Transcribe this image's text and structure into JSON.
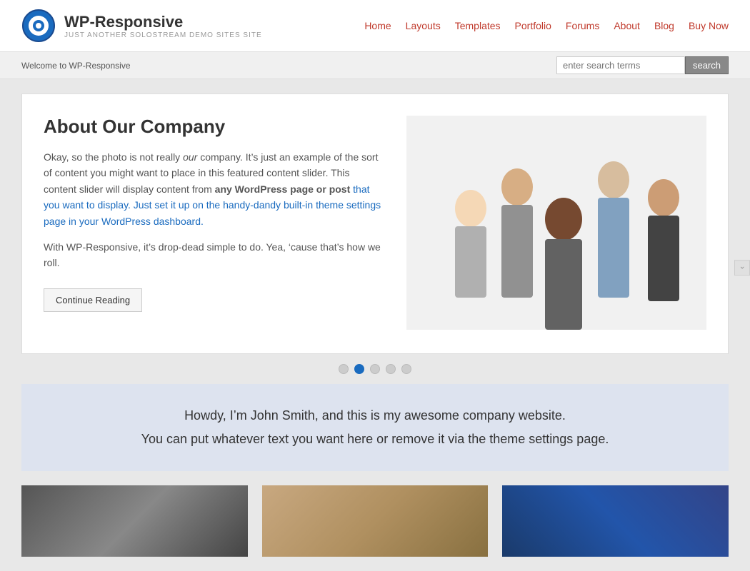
{
  "site": {
    "logo_title": "WP-Responsive",
    "logo_subtitle": "Just another Solostream demo sites site",
    "logo_icon_color_outer": "#1a6bbf",
    "logo_icon_color_inner": "#fff"
  },
  "nav": {
    "items": [
      {
        "label": "Home",
        "url": "#"
      },
      {
        "label": "Layouts",
        "url": "#"
      },
      {
        "label": "Templates",
        "url": "#"
      },
      {
        "label": "Portfolio",
        "url": "#"
      },
      {
        "label": "Forums",
        "url": "#"
      },
      {
        "label": "About",
        "url": "#"
      },
      {
        "label": "Blog",
        "url": "#"
      },
      {
        "label": "Buy Now",
        "url": "#"
      }
    ]
  },
  "toolbar": {
    "welcome_text": "Welcome to WP-Responsive"
  },
  "search": {
    "placeholder": "enter search terms",
    "button_label": "search"
  },
  "slide": {
    "title": "About Our Company",
    "paragraph1_plain": "Okay, so the photo is not really ",
    "paragraph1_italic": "our",
    "paragraph1_rest": " company. It’s just an example of the sort of content you might want to place in this featured content slider. This content slider will display content from ",
    "paragraph1_bold": "any WordPress page or post",
    "paragraph1_end": " that you want to display. Just set it up on the handy-dandy built-in theme settings page in your WordPress dashboard.",
    "paragraph2": "With WP-Responsive, it’s drop-dead simple to do. Yea, ‘cause that’s how we roll.",
    "continue_btn": "Continue Reading"
  },
  "dots": {
    "count": 5,
    "active_index": 1
  },
  "intro": {
    "line1": "Howdy, I’m John Smith, and this is my awesome company website.",
    "line2": "You can put whatever text you want here or remove it via the theme settings page."
  }
}
